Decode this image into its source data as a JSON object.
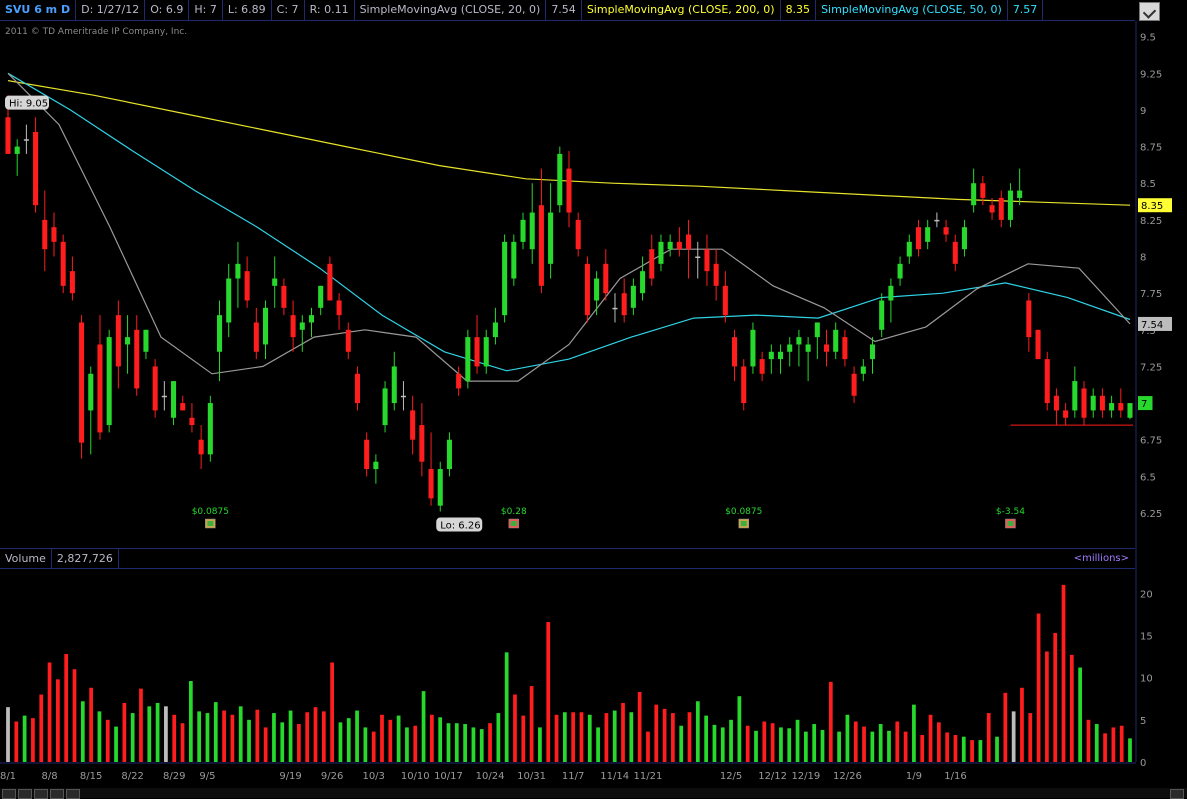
{
  "header": {
    "symbol": "SVU 6 m D",
    "date": "D: 1/27/12",
    "open": "O: 6.9",
    "high": "H: 7",
    "low": "L: 6.89",
    "close": "C: 7",
    "range": "R: 0.11",
    "sma20_label": "SimpleMovingAvg (CLOSE, 20, 0)",
    "sma20_value": "7.54",
    "sma200_label": "SimpleMovingAvg (CLOSE, 200, 0)",
    "sma200_value": "8.35",
    "sma50_label": "SimpleMovingAvg (CLOSE, 50, 0)",
    "sma50_value": "7.57",
    "copyright": "2011 © TD Ameritrade IP Company, Inc."
  },
  "volume_header": {
    "label": "Volume",
    "value": "2,827,726",
    "units": "<millions>"
  },
  "colors": {
    "up": "#27d82d",
    "down": "#ff1d1d",
    "neutral": "#bdbdbd",
    "sma20": "#9a9a9a",
    "sma50": "#2fd3e6",
    "sma200": "#e6e22a",
    "axis_text": "#9a9a9a"
  },
  "chart_data": [
    {
      "type": "candlestick",
      "title": "SVU 6 m D",
      "ylim": [
        6.1,
        9.6
      ],
      "y_ticks": [
        "9.5",
        "9.25",
        "9",
        "8.75",
        "8.5",
        "8.25",
        "8",
        "7.75",
        "7.5",
        "7.25",
        "7",
        "6.75",
        "6.5",
        "6.25"
      ],
      "y_tick_values": [
        9.5,
        9.25,
        9.0,
        8.75,
        8.5,
        8.25,
        8.0,
        7.75,
        7.5,
        7.25,
        7.0,
        6.75,
        6.5,
        6.25
      ],
      "x_labels": [
        "8/1",
        "8/8",
        "8/15",
        "8/22",
        "8/29",
        "9/5",
        "9/19",
        "9/26",
        "10/3",
        "10/10",
        "10/17",
        "10/24",
        "10/31",
        "11/7",
        "11/14",
        "11/21",
        "12/5",
        "12/12",
        "12/19",
        "12/26",
        "1/9",
        "1/16"
      ],
      "x_label_index": [
        0,
        5,
        10,
        15,
        20,
        24,
        34,
        39,
        44,
        49,
        53,
        58,
        63,
        68,
        73,
        77,
        87,
        92,
        96,
        101,
        109,
        114
      ],
      "ohlc": [
        [
          8.95,
          9.1,
          8.7,
          8.7
        ],
        [
          8.7,
          8.8,
          8.55,
          8.75
        ],
        [
          8.8,
          8.9,
          8.7,
          8.8
        ],
        [
          8.85,
          8.95,
          8.3,
          8.35
        ],
        [
          8.25,
          8.45,
          7.9,
          8.05
        ],
        [
          8.2,
          8.3,
          8.0,
          8.1
        ],
        [
          8.1,
          8.15,
          7.75,
          7.8
        ],
        [
          7.9,
          8.0,
          7.7,
          7.75
        ],
        [
          7.55,
          7.6,
          6.62,
          6.73
        ],
        [
          6.95,
          7.25,
          6.65,
          7.2
        ],
        [
          7.4,
          7.6,
          6.75,
          6.8
        ],
        [
          6.85,
          7.5,
          6.8,
          7.45
        ],
        [
          7.6,
          7.7,
          7.1,
          7.25
        ],
        [
          7.4,
          7.6,
          7.2,
          7.45
        ],
        [
          7.5,
          7.6,
          7.05,
          7.1
        ],
        [
          7.35,
          7.5,
          7.3,
          7.5
        ],
        [
          7.25,
          7.3,
          6.9,
          6.95
        ],
        [
          7.05,
          7.15,
          6.95,
          7.05
        ],
        [
          6.9,
          7.15,
          6.85,
          7.15
        ],
        [
          7.0,
          7.05,
          6.95,
          6.95
        ],
        [
          6.9,
          7.0,
          6.8,
          6.85
        ],
        [
          6.75,
          6.85,
          6.55,
          6.65
        ],
        [
          6.65,
          7.05,
          6.6,
          7.0
        ],
        [
          7.35,
          7.7,
          7.15,
          7.6
        ],
        [
          7.55,
          7.95,
          7.45,
          7.85
        ],
        [
          7.85,
          8.1,
          7.65,
          7.95
        ],
        [
          7.9,
          8.0,
          7.65,
          7.7
        ],
        [
          7.55,
          7.65,
          7.3,
          7.35
        ],
        [
          7.4,
          7.7,
          7.3,
          7.65
        ],
        [
          7.8,
          8.0,
          7.65,
          7.85
        ],
        [
          7.8,
          7.85,
          7.6,
          7.65
        ],
        [
          7.6,
          7.7,
          7.35,
          7.45
        ],
        [
          7.5,
          7.6,
          7.35,
          7.55
        ],
        [
          7.55,
          7.65,
          7.45,
          7.6
        ],
        [
          7.65,
          7.8,
          7.6,
          7.8
        ],
        [
          7.95,
          8.0,
          7.7,
          7.7
        ],
        [
          7.7,
          7.75,
          7.5,
          7.6
        ],
        [
          7.5,
          7.55,
          7.3,
          7.35
        ],
        [
          7.2,
          7.25,
          6.95,
          7.0
        ],
        [
          6.75,
          6.8,
          6.5,
          6.55
        ],
        [
          6.55,
          6.65,
          6.45,
          6.6
        ],
        [
          6.85,
          7.15,
          6.8,
          7.1
        ],
        [
          7.0,
          7.35,
          6.95,
          7.25
        ],
        [
          7.05,
          7.15,
          6.95,
          7.05
        ],
        [
          6.95,
          7.05,
          6.65,
          6.75
        ],
        [
          6.85,
          7.0,
          6.5,
          6.6
        ],
        [
          6.55,
          6.8,
          6.3,
          6.35
        ],
        [
          6.3,
          6.6,
          6.26,
          6.55
        ],
        [
          6.55,
          6.8,
          6.5,
          6.75
        ],
        [
          7.2,
          7.25,
          7.05,
          7.1
        ],
        [
          7.15,
          7.5,
          7.1,
          7.45
        ],
        [
          7.45,
          7.6,
          7.2,
          7.25
        ],
        [
          7.25,
          7.5,
          7.2,
          7.45
        ],
        [
          7.45,
          7.65,
          7.4,
          7.55
        ],
        [
          7.6,
          8.15,
          7.55,
          8.1
        ],
        [
          7.85,
          8.15,
          7.8,
          8.1
        ],
        [
          8.1,
          8.3,
          8.05,
          8.25
        ],
        [
          8.05,
          8.5,
          7.95,
          8.3
        ],
        [
          8.35,
          8.6,
          7.75,
          7.8
        ],
        [
          7.95,
          8.5,
          7.85,
          8.3
        ],
        [
          8.35,
          8.75,
          8.3,
          8.7
        ],
        [
          8.6,
          8.72,
          8.2,
          8.3
        ],
        [
          8.25,
          8.3,
          8.0,
          8.05
        ],
        [
          7.95,
          8.0,
          7.55,
          7.6
        ],
        [
          7.7,
          7.9,
          7.6,
          7.85
        ],
        [
          7.95,
          8.05,
          7.7,
          7.75
        ],
        [
          7.65,
          7.75,
          7.55,
          7.65
        ],
        [
          7.75,
          7.85,
          7.55,
          7.6
        ],
        [
          7.65,
          7.85,
          7.6,
          7.8
        ],
        [
          7.75,
          8.0,
          7.7,
          7.9
        ],
        [
          8.05,
          8.15,
          7.8,
          7.85
        ],
        [
          7.95,
          8.15,
          7.9,
          8.1
        ],
        [
          8.05,
          8.15,
          8.0,
          8.1
        ],
        [
          8.1,
          8.2,
          8.0,
          8.05
        ],
        [
          8.15,
          8.25,
          7.85,
          8.05
        ],
        [
          8.0,
          8.1,
          7.85,
          8.0
        ],
        [
          8.05,
          8.15,
          7.8,
          7.9
        ],
        [
          7.95,
          8.05,
          7.7,
          7.8
        ],
        [
          7.8,
          7.9,
          7.55,
          7.6
        ],
        [
          7.45,
          7.5,
          7.15,
          7.25
        ],
        [
          7.25,
          7.3,
          6.95,
          7.0
        ],
        [
          7.25,
          7.55,
          7.2,
          7.5
        ],
        [
          7.3,
          7.35,
          7.15,
          7.2
        ],
        [
          7.3,
          7.4,
          7.2,
          7.35
        ],
        [
          7.3,
          7.4,
          7.2,
          7.35
        ],
        [
          7.35,
          7.45,
          7.25,
          7.4
        ],
        [
          7.4,
          7.5,
          7.25,
          7.45
        ],
        [
          7.35,
          7.45,
          7.15,
          7.4
        ],
        [
          7.45,
          7.55,
          7.3,
          7.55
        ],
        [
          7.4,
          7.5,
          7.25,
          7.35
        ],
        [
          7.35,
          7.55,
          7.3,
          7.5
        ],
        [
          7.45,
          7.5,
          7.25,
          7.3
        ],
        [
          7.2,
          7.25,
          7.0,
          7.05
        ],
        [
          7.2,
          7.3,
          7.15,
          7.25
        ],
        [
          7.3,
          7.45,
          7.2,
          7.4
        ],
        [
          7.5,
          7.75,
          7.45,
          7.7
        ],
        [
          7.7,
          7.85,
          7.55,
          7.8
        ],
        [
          7.85,
          8.0,
          7.8,
          7.95
        ],
        [
          8.0,
          8.15,
          7.95,
          8.1
        ],
        [
          8.2,
          8.25,
          8.0,
          8.05
        ],
        [
          8.1,
          8.25,
          8.05,
          8.2
        ],
        [
          8.25,
          8.3,
          8.2,
          8.25
        ],
        [
          8.2,
          8.25,
          8.1,
          8.15
        ],
        [
          8.1,
          8.15,
          7.9,
          7.95
        ],
        [
          8.05,
          8.25,
          8.0,
          8.2
        ],
        [
          8.35,
          8.6,
          8.3,
          8.5
        ],
        [
          8.5,
          8.55,
          8.35,
          8.4
        ],
        [
          8.35,
          8.4,
          8.25,
          8.3
        ],
        [
          8.4,
          8.45,
          8.2,
          8.25
        ],
        [
          8.25,
          8.5,
          8.2,
          8.45
        ],
        [
          8.4,
          8.6,
          8.35,
          8.45
        ],
        [
          7.7,
          7.75,
          7.35,
          7.45
        ],
        [
          7.5,
          7.5,
          7.3,
          7.3
        ],
        [
          7.3,
          7.35,
          6.95,
          7.0
        ],
        [
          7.05,
          7.1,
          6.85,
          6.95
        ],
        [
          6.95,
          7.0,
          6.85,
          6.9
        ],
        [
          6.95,
          7.25,
          6.9,
          7.15
        ],
        [
          7.1,
          7.15,
          6.85,
          6.9
        ],
        [
          6.95,
          7.1,
          6.9,
          7.05
        ],
        [
          7.05,
          7.1,
          6.9,
          6.95
        ],
        [
          6.95,
          7.05,
          6.9,
          7.0
        ],
        [
          7.0,
          7.1,
          6.9,
          6.95
        ],
        [
          6.9,
          7.0,
          6.89,
          7.0
        ]
      ],
      "sma200": [
        9.2,
        9.1,
        8.98,
        8.86,
        8.74,
        8.62,
        8.53,
        8.5,
        8.48,
        8.45,
        8.42,
        8.39,
        8.37,
        8.35
      ],
      "sma50": [
        9.25,
        9.0,
        8.72,
        8.45,
        8.2,
        7.92,
        7.6,
        7.35,
        7.22,
        7.3,
        7.45,
        7.58,
        7.6,
        7.58,
        7.72,
        7.75,
        7.82,
        7.72,
        7.57
      ],
      "sma20": [
        9.25,
        8.9,
        8.2,
        7.45,
        7.2,
        7.25,
        7.45,
        7.5,
        7.45,
        7.15,
        7.15,
        7.4,
        7.85,
        8.05,
        8.05,
        7.8,
        7.65,
        7.42,
        7.52,
        7.78,
        7.95,
        7.92,
        7.54
      ],
      "series": [
        {
          "name": "SimpleMovingAvg (CLOSE, 20, 0)",
          "last": 7.54
        },
        {
          "name": "SimpleMovingAvg (CLOSE, 200, 0)",
          "last": 8.35
        },
        {
          "name": "SimpleMovingAvg (CLOSE, 50, 0)",
          "last": 7.57
        }
      ],
      "annotations": {
        "hi_label": "Hi: 9.05",
        "lo_label": "Lo: 6.26",
        "dividends": [
          {
            "label": "$0.0875",
            "index": 22
          },
          {
            "label": "$0.28",
            "index": 55
          },
          {
            "label": "$0.0875",
            "index": 80
          },
          {
            "label": "$-3.54",
            "index": 109
          }
        ],
        "support_line": 6.85
      },
      "price_badges": [
        {
          "text": "8.35",
          "value": 8.35,
          "color": "#ffff33"
        },
        {
          "text": "7.54",
          "value": 7.54,
          "color": "#bdbdbd"
        },
        {
          "text": "7",
          "value": 7.0,
          "color": "#27d82d"
        }
      ]
    },
    {
      "type": "bar",
      "title": "Volume",
      "ylim": [
        0,
        23
      ],
      "y_ticks": [
        "20",
        "15",
        "10",
        "5",
        "0"
      ],
      "y_tick_values": [
        20,
        15,
        10,
        5,
        0
      ],
      "units": "millions",
      "values": [
        6.5,
        4.8,
        5.5,
        5.2,
        8.0,
        11.8,
        9.8,
        12.8,
        11.0,
        7.2,
        8.8,
        6.0,
        5.0,
        4.2,
        7.0,
        5.8,
        8.7,
        6.6,
        7.0,
        6.6,
        5.6,
        4.6,
        9.6,
        6.0,
        5.8,
        7.1,
        6.1,
        5.6,
        6.6,
        5.0,
        6.2,
        4.1,
        5.8,
        4.7,
        6.1,
        4.5,
        5.9,
        6.5,
        6.0,
        11.8,
        4.7,
        5.2,
        6.1,
        4.1,
        3.6,
        5.6,
        5.0,
        5.5,
        4.1,
        4.3,
        8.4,
        5.6,
        5.3,
        4.6,
        4.6,
        4.5,
        4.1,
        3.9,
        4.6,
        5.8,
        13.0,
        8.0,
        5.5,
        9.0,
        4.1,
        16.6,
        5.6,
        5.9,
        5.9,
        5.9,
        5.6,
        4.1,
        5.8,
        6.1,
        7.0,
        5.9,
        8.3,
        3.6,
        6.8,
        6.3,
        5.8,
        4.3,
        5.9,
        7.2,
        5.5,
        4.4,
        4.1,
        5.0,
        7.8,
        4.3,
        3.7,
        4.8,
        4.6,
        4.1,
        4.0,
        5.0,
        3.6,
        4.5,
        3.8,
        9.5,
        3.6,
        5.6,
        4.8,
        4.2,
        3.6,
        4.5,
        3.7,
        4.8,
        3.6,
        6.8,
        3.2,
        5.6,
        4.7,
        3.5,
        3.2,
        3.0,
        2.6,
        2.6,
        5.8,
        3.0,
        8.2,
        6.0,
        8.8,
        5.8,
        17.6,
        13.1,
        15.3,
        21.0,
        12.7,
        11.2,
        5.0,
        4.5,
        3.4,
        4.1,
        4.3,
        2.8
      ],
      "directions": [
        "n",
        "d",
        "u",
        "d",
        "d",
        "d",
        "d",
        "d",
        "d",
        "u",
        "d",
        "u",
        "d",
        "u",
        "d",
        "u",
        "d",
        "u",
        "u",
        "n",
        "d",
        "d",
        "u",
        "u",
        "u",
        "u",
        "d",
        "d",
        "u",
        "u",
        "d",
        "d",
        "u",
        "u",
        "u",
        "d",
        "d",
        "d",
        "d",
        "d",
        "u",
        "u",
        "u",
        "u",
        "d",
        "d",
        "d",
        "u",
        "u",
        "d",
        "u",
        "d",
        "u",
        "u",
        "u",
        "u",
        "u",
        "u",
        "d",
        "u",
        "u",
        "d",
        "d",
        "d",
        "u",
        "d",
        "d",
        "u",
        "d",
        "d",
        "u",
        "u",
        "d",
        "u",
        "d",
        "u",
        "d",
        "d",
        "d",
        "d",
        "d",
        "u",
        "d",
        "u",
        "u",
        "u",
        "u",
        "u",
        "u",
        "d",
        "u",
        "d",
        "d",
        "u",
        "u",
        "u",
        "u",
        "u",
        "u",
        "d",
        "u",
        "u",
        "d",
        "d",
        "u",
        "u",
        "u",
        "d",
        "d",
        "u",
        "d",
        "d",
        "d",
        "d",
        "d",
        "u",
        "d",
        "u",
        "d",
        "u",
        "d",
        "n",
        "d",
        "d",
        "d",
        "d",
        "d",
        "d",
        "d",
        "u",
        "d",
        "u",
        "d",
        "d",
        "d",
        "u"
      ]
    }
  ]
}
